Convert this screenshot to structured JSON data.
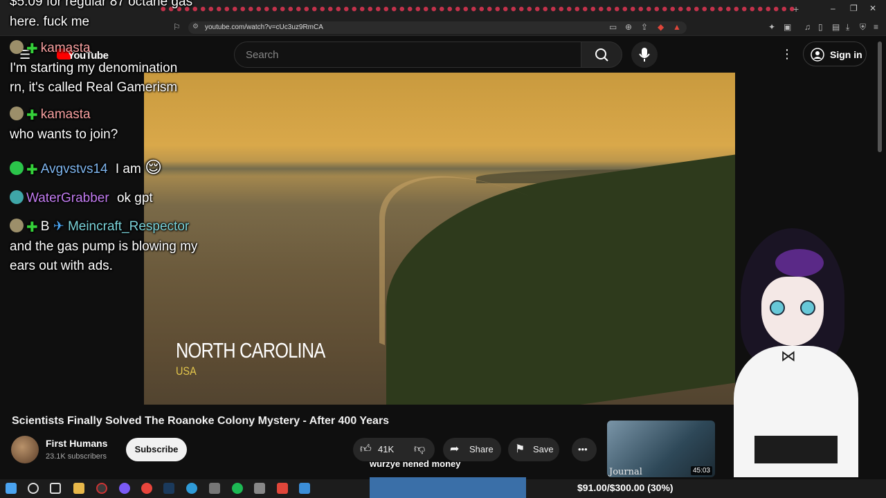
{
  "browser": {
    "url": "youtube.com/watch?v=cUc3uz9RmCA",
    "new_tab": "+",
    "window_controls": [
      "–",
      "❐",
      "✕"
    ]
  },
  "youtube": {
    "logo_text": "YouTube",
    "search_placeholder": "Search",
    "sign_in": "Sign in",
    "video_title": "Scientists Finally Solved The Roanoke Colony Mystery - After 400 Years",
    "channel_name": "First Humans",
    "subscribers": "23.1K subscribers",
    "subscribe_label": "Subscribe",
    "likes": "41K",
    "share_label": "Share",
    "save_label": "Save",
    "more_label": "•••",
    "video_overlay": {
      "location_title": "NORTH CAROLINA",
      "location_subtitle": "USA"
    },
    "recommended": {
      "thumb_text": "Journal",
      "duration": "45:03"
    }
  },
  "chat": [
    {
      "name": "",
      "message": "$5.09 for regular 87 octane gas"
    },
    {
      "name": "",
      "message": "here. fuck me"
    },
    {
      "name": "kamasta",
      "color": "#f7a0a0",
      "message": ""
    },
    {
      "name": "",
      "message": "I'm starting my denomination"
    },
    {
      "name": "",
      "message": "rn, it's called Real Gamerism"
    },
    {
      "name": "kamasta",
      "color": "#f7a0a0",
      "message": ""
    },
    {
      "name": "",
      "message": "who wants to join?"
    },
    {
      "name": "Avgvstvs14",
      "color": "#7fb6ef",
      "message": "I am"
    },
    {
      "name": "WaterGrabber",
      "color": "#c27cf0",
      "message": "ok gpt"
    },
    {
      "name": "Meincraft_Respector",
      "color": "#7ad3d9",
      "message": "B"
    },
    {
      "name": "",
      "message": "and the gas pump is blowing my"
    },
    {
      "name": "",
      "message": "ears out with ads."
    }
  ],
  "stream": {
    "donation_message": "wurzye nened money",
    "donation_goal": "$91.00/$300.00 (30%)",
    "donation_progress": 0.3
  },
  "colors": {
    "accent_red": "#ff0000",
    "donation_bar": "#3a6fa8",
    "chat_badge_green": "#35d13a"
  }
}
